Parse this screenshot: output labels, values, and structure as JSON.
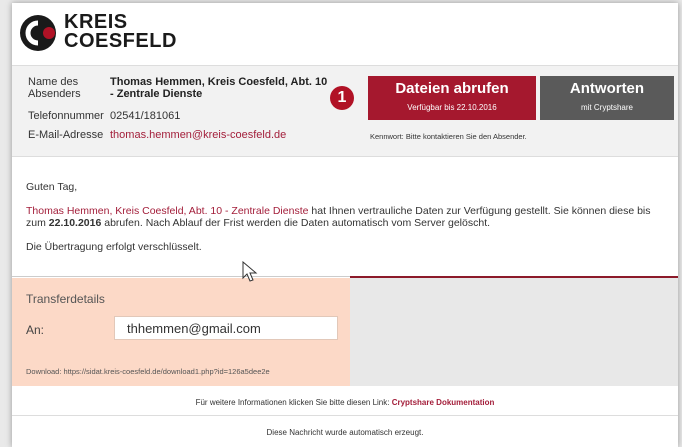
{
  "logo": {
    "line1": "KREIS",
    "line2": "COESFELD"
  },
  "sender": {
    "name_label": "Name des Absenders",
    "name_value": "Thomas Hemmen, Kreis Coesfeld, Abt. 10 - Zentrale Dienste",
    "phone_label": "Telefonnummer",
    "phone_value": "02541/181061",
    "email_label": "E-Mail-Adresse",
    "email_value": "thomas.hemmen@kreis-coesfeld.de"
  },
  "badge": "1",
  "download_button": {
    "title": "Dateien abrufen",
    "subtitle": "Verfügbar bis 22.10.2016"
  },
  "reply_button": {
    "title": "Antworten",
    "subtitle": "mit Cryptshare"
  },
  "kennwort": "Kennwort: Bitte kontaktieren Sie den Absender.",
  "message": {
    "greeting": "Guten Tag,",
    "sender_link": "Thomas Hemmen, Kreis Coesfeld, Abt. 10 - Zentrale Dienste",
    "body_part1": " hat Ihnen vertrauliche Daten zur Verfügung gestellt. Sie können diese bis zum ",
    "date": "22.10.2016",
    "body_part2": " abrufen. Nach Ablauf der Frist werden die Daten automatisch vom Server gelöscht.",
    "encryption": "Die Übertragung erfolgt verschlüsselt."
  },
  "transfer": {
    "title": "Transferdetails",
    "to_label": "An:",
    "to_value": "thhemmen@gmail.com",
    "download_url": "Download: https://sidat.kreis-coesfeld.de/download1.php?id=126a5dee2e"
  },
  "footer": {
    "info_text": "Für weitere Informationen klicken Sie bitte diesen Link: ",
    "info_link": "Cryptshare Dokumentation",
    "auto_text": "Diese Nachricht wurde automatisch erzeugt."
  },
  "colors": {
    "brand_red": "#a5182e",
    "gray_button": "#5a5a5a",
    "transfer_bg": "#fcd9c7"
  }
}
